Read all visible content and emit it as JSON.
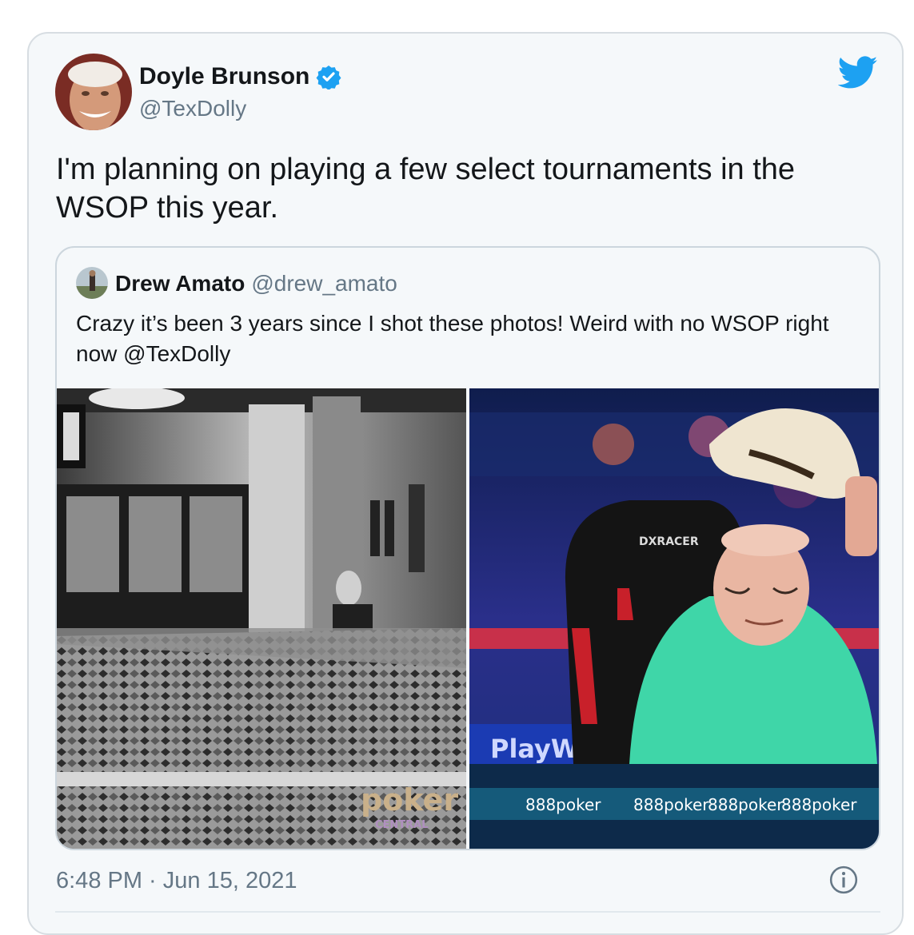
{
  "tweet": {
    "author_name": "Doyle Brunson",
    "author_handle": "@TexDolly",
    "text": "I'm planning on playing a few select tournaments in the WSOP this year.",
    "timestamp": "6:48 PM · Jun 15, 2021",
    "verified_icon": "verified-badge-icon",
    "logo_icon": "twitter-bird-icon",
    "info_icon": "info-icon"
  },
  "quoted_tweet": {
    "author_name": "Drew Amato",
    "author_handle": "@drew_amato",
    "text": "Crazy it’s been 3 years since I shot these photos! Weird with no WSOP right now  @TexDolly",
    "photos": [
      {
        "watermark_main": "poker",
        "watermark_sub": "CENTRAL"
      },
      {
        "chair_brand": "DXRACER",
        "banner_text": "PlayW",
        "table_text": [
          "888poker",
          "888poker",
          "888poker",
          "888poker"
        ]
      }
    ]
  },
  "colors": {
    "card_background": "#f5f8fa",
    "twitter_blue": "#1da1f2",
    "text_primary": "#14171a",
    "text_secondary": "#657786"
  }
}
